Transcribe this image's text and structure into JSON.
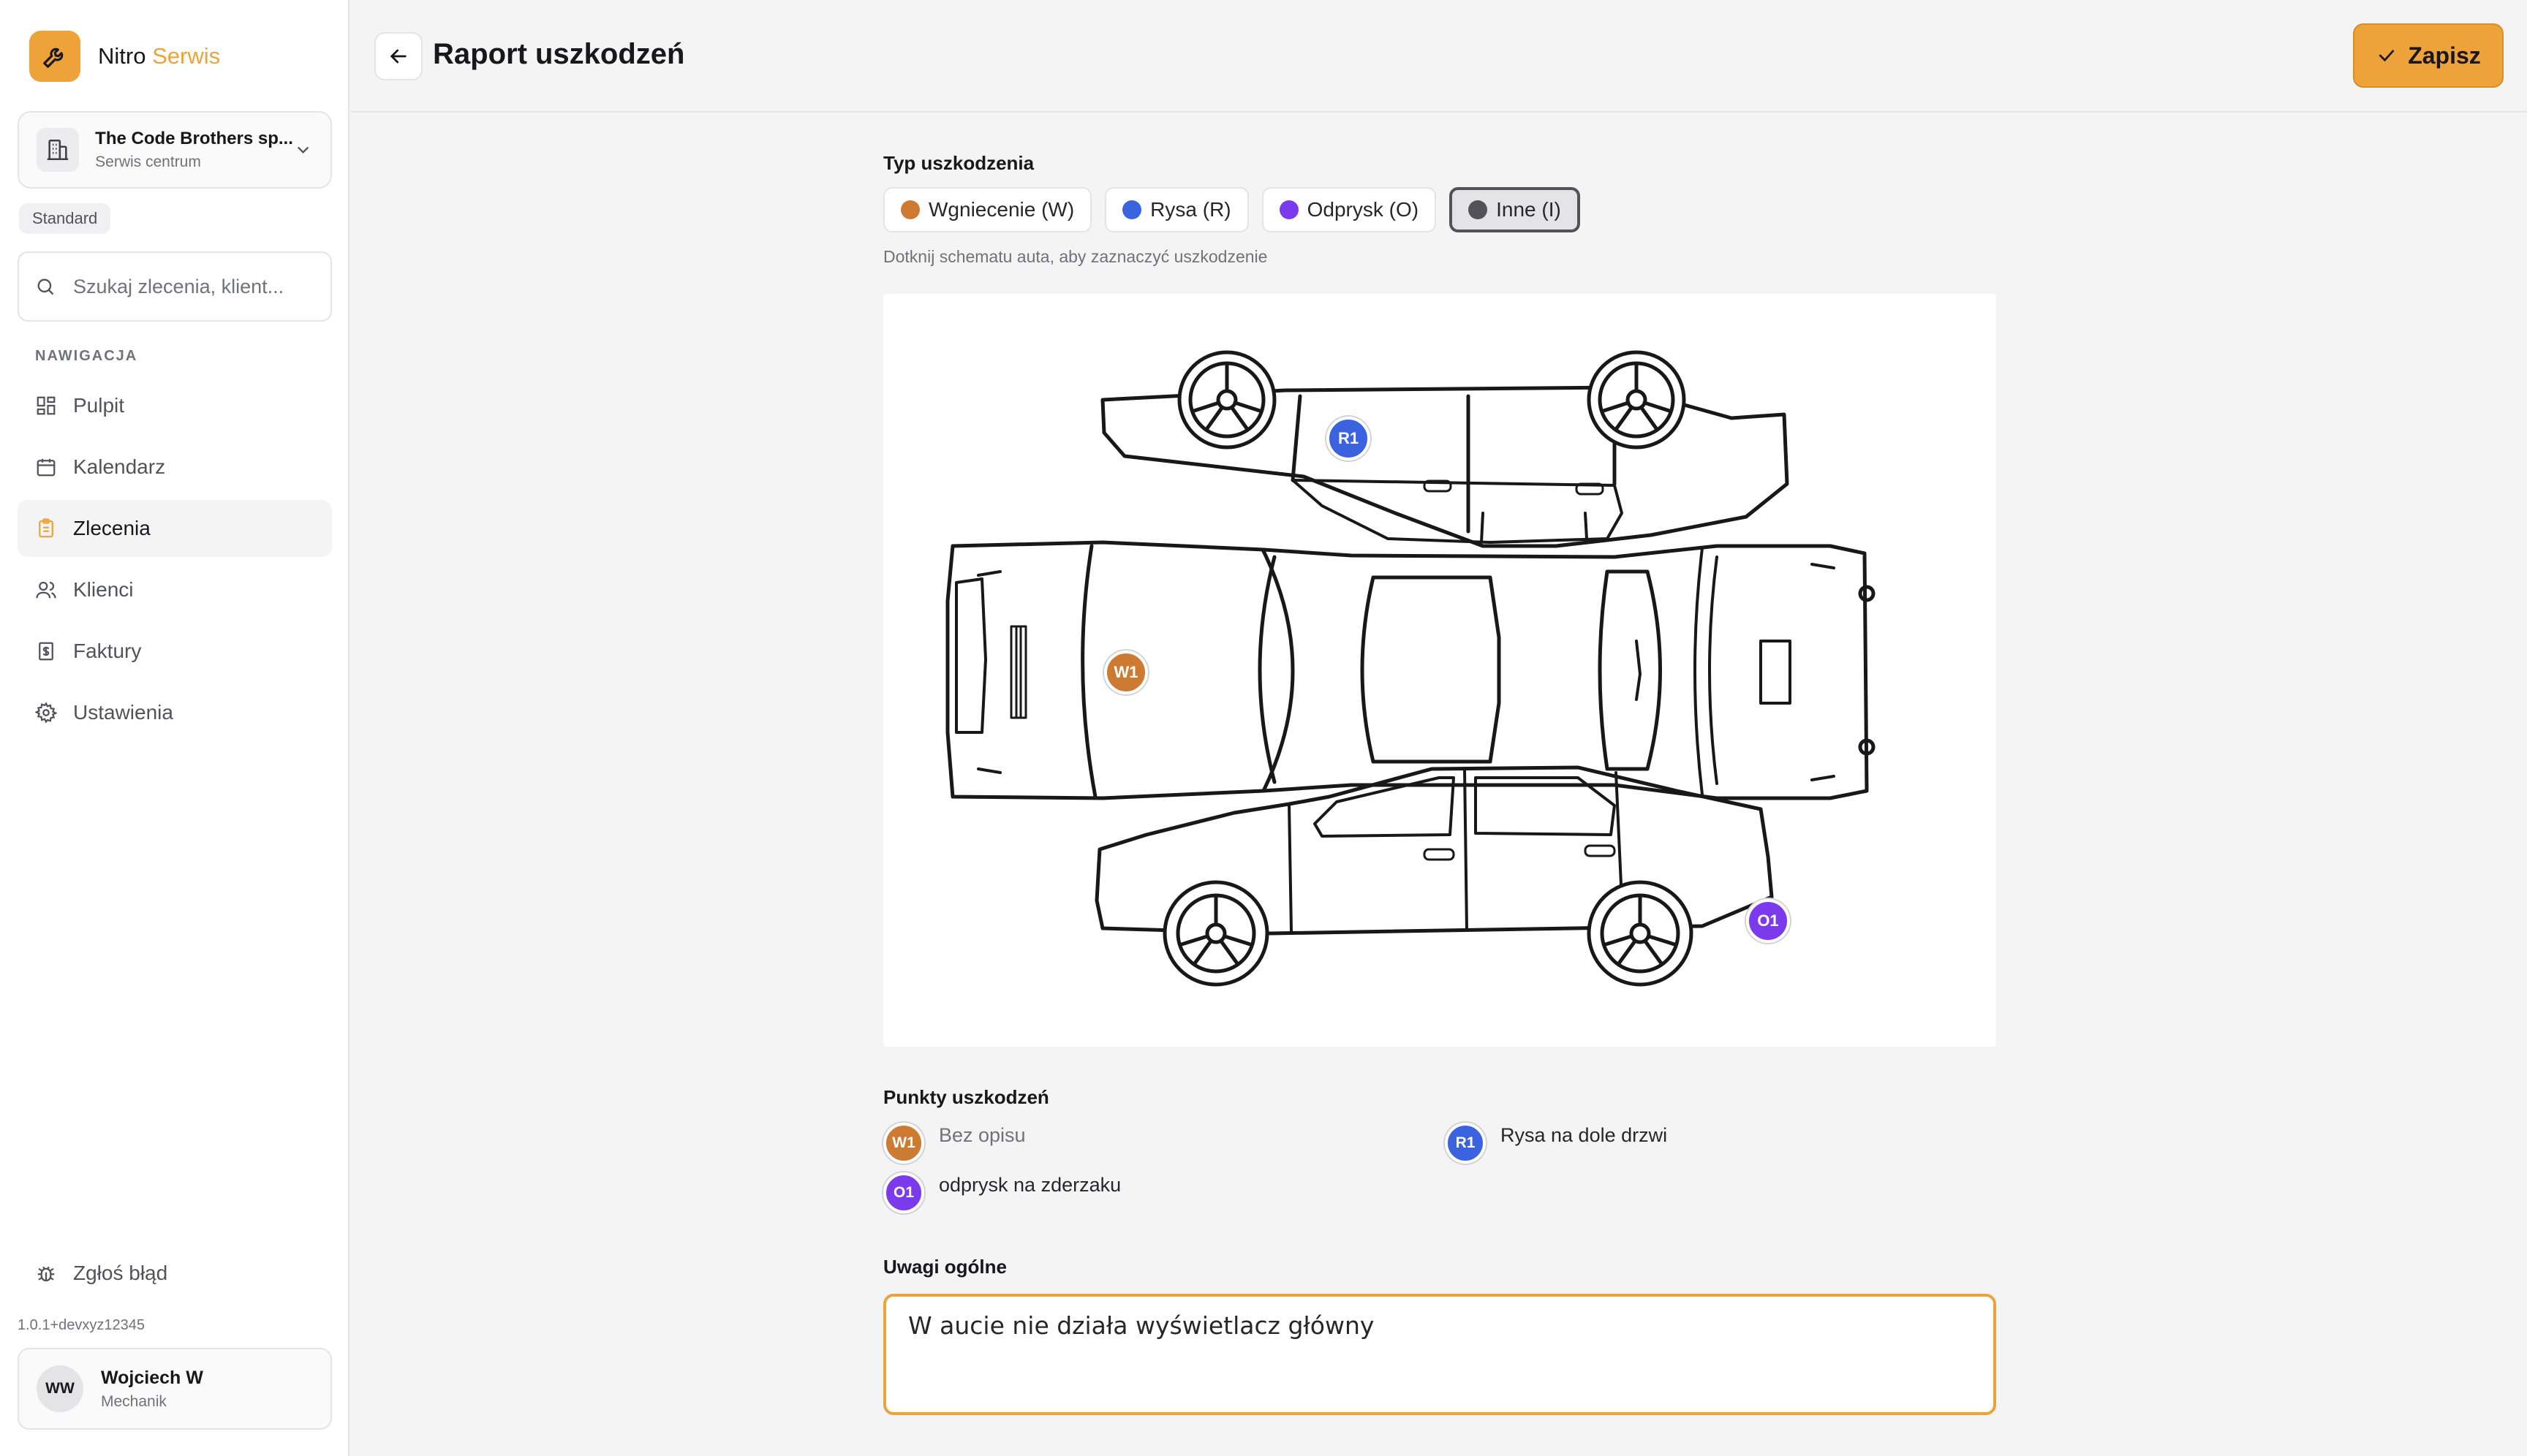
{
  "brand": {
    "name": "Nitro",
    "accent": "Serwis",
    "accent_color": "#eea23a",
    "logo_icon": "wrench-icon"
  },
  "workspace": {
    "name": "The Code Brothers sp...",
    "subtitle": "Serwis centrum",
    "icon": "building-icon"
  },
  "plan": "Standard",
  "search": {
    "placeholder": "Szukaj zlecenia, klient...",
    "value": ""
  },
  "nav": {
    "label": "NAWIGACJA",
    "items": [
      {
        "label": "Pulpit",
        "icon": "dashboard-icon"
      },
      {
        "label": "Kalendarz",
        "icon": "calendar-icon"
      },
      {
        "label": "Zlecenia",
        "icon": "clipboard-icon",
        "active": true
      },
      {
        "label": "Klienci",
        "icon": "users-icon"
      },
      {
        "label": "Faktury",
        "icon": "invoice-icon"
      },
      {
        "label": "Ustawienia",
        "icon": "gear-icon"
      }
    ]
  },
  "footer": {
    "report_bug": "Zgłoś błąd",
    "version": "1.0.1+devxyz12345",
    "user": {
      "initials": "WW",
      "name": "Wojciech W",
      "role": "Mechanik"
    }
  },
  "header": {
    "title": "Raport uszkodzeń",
    "save_label": "Zapisz"
  },
  "damage_type": {
    "label": "Typ uszkodzenia",
    "options": [
      {
        "label": "Wgniecenie (W)",
        "color": "#cd7a32"
      },
      {
        "label": "Rysa (R)",
        "color": "#3b63e0"
      },
      {
        "label": "Odprysk (O)",
        "color": "#7c3aed"
      },
      {
        "label": "Inne (I)",
        "color": "#52525b",
        "selected": true
      }
    ],
    "hint": "Dotknij schematu auta, aby zaznaczyć uszkodzenie"
  },
  "markers": [
    {
      "code": "W1",
      "color": "#cd7a32"
    },
    {
      "code": "R1",
      "color": "#3b63e0"
    },
    {
      "code": "O1",
      "color": "#7c3aed"
    }
  ],
  "points": {
    "label": "Punkty uszkodzeń",
    "items": [
      {
        "code": "W1",
        "color": "#cd7a32",
        "text": "Bez opisu",
        "empty": true
      },
      {
        "code": "R1",
        "color": "#3b63e0",
        "text": "Rysa na dole drzwi"
      },
      {
        "code": "O1",
        "color": "#7c3aed",
        "text": "odprysk na zderzaku"
      }
    ]
  },
  "notes": {
    "label": "Uwagi ogólne",
    "value": "W aucie nie działa wyświetlacz główny"
  }
}
